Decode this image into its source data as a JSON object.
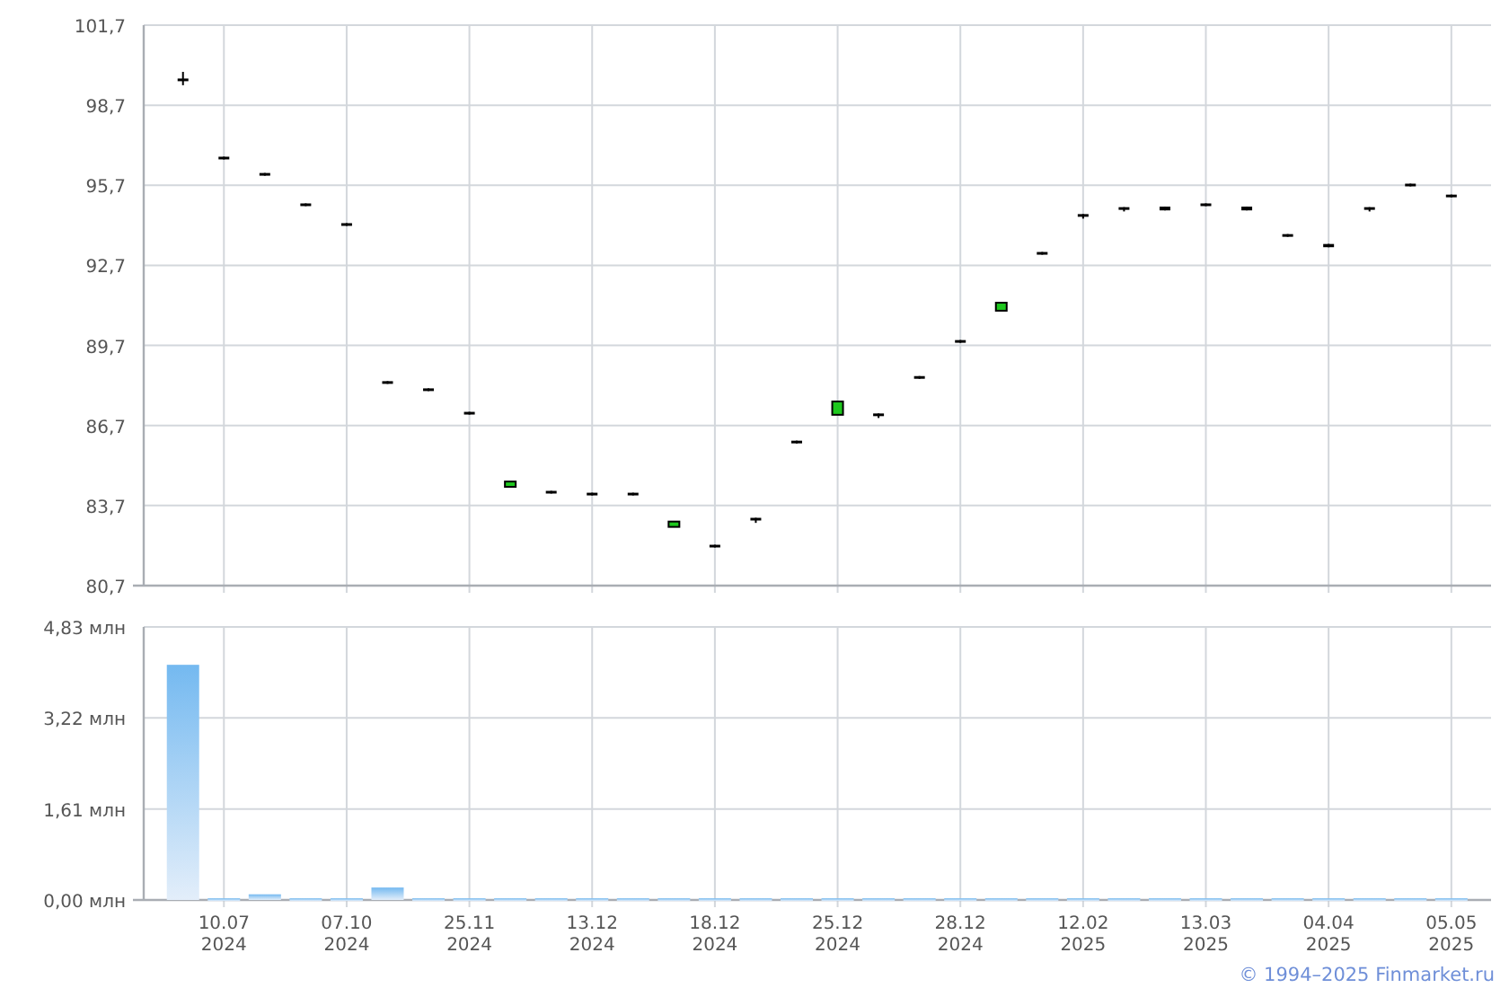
{
  "price_chart": {
    "chart_data": {
      "type": "candlestick",
      "categories": [
        null,
        null,
        null,
        null,
        null,
        null,
        null,
        null,
        null,
        null,
        null,
        null,
        null,
        null,
        null,
        null,
        null,
        null,
        null,
        null,
        null,
        null,
        null,
        null,
        null,
        null,
        null,
        null,
        null,
        null,
        null,
        null
      ],
      "grid": true,
      "ohlc": [
        [
          99.7,
          99.95,
          99.45,
          99.6
        ],
        [
          96.77,
          96.77,
          96.67,
          96.67
        ],
        [
          96.16,
          96.16,
          96.06,
          96.06
        ],
        [
          95.02,
          95.02,
          94.92,
          94.92
        ],
        [
          94.28,
          94.28,
          94.18,
          94.18
        ],
        [
          88.36,
          88.36,
          88.26,
          88.26
        ],
        [
          88.09,
          88.09,
          87.99,
          87.99
        ],
        [
          87.21,
          87.21,
          87.11,
          87.11
        ],
        [
          84.4,
          84.6,
          84.4,
          84.6
        ],
        [
          84.25,
          84.25,
          84.15,
          84.15
        ],
        [
          84.18,
          84.18,
          84.08,
          84.08
        ],
        [
          84.18,
          84.18,
          84.08,
          84.08
        ],
        [
          82.9,
          83.1,
          82.9,
          83.1
        ],
        [
          82.23,
          82.23,
          82.13,
          82.13
        ],
        [
          83.24,
          83.24,
          83.05,
          83.14
        ],
        [
          86.13,
          86.13,
          86.03,
          86.03
        ],
        [
          87.1,
          87.6,
          87.1,
          87.6
        ],
        [
          87.15,
          87.15,
          86.98,
          87.05
        ],
        [
          88.55,
          88.55,
          88.45,
          88.45
        ],
        [
          89.9,
          89.9,
          89.8,
          89.8
        ],
        [
          91.0,
          91.3,
          91.0,
          91.3
        ],
        [
          93.2,
          93.2,
          93.1,
          93.1
        ],
        [
          94.62,
          94.62,
          94.45,
          94.52
        ],
        [
          94.88,
          94.88,
          94.72,
          94.78
        ],
        [
          94.9,
          94.9,
          94.76,
          94.76
        ],
        [
          95.02,
          95.02,
          94.92,
          94.92
        ],
        [
          94.9,
          94.9,
          94.76,
          94.76
        ],
        [
          93.87,
          93.87,
          93.77,
          93.77
        ],
        [
          93.5,
          93.5,
          93.38,
          93.38
        ],
        [
          94.88,
          94.88,
          94.72,
          94.78
        ],
        [
          95.76,
          95.76,
          95.66,
          95.66
        ],
        [
          95.35,
          95.35,
          95.25,
          95.25
        ]
      ],
      "ylim": [
        80.7,
        101.7
      ],
      "yticks": [
        {
          "value": 80.7,
          "label": "80,7"
        },
        {
          "value": 83.7,
          "label": "83,7"
        },
        {
          "value": 86.7,
          "label": "86,7"
        },
        {
          "value": 89.7,
          "label": "89,7"
        },
        {
          "value": 92.7,
          "label": "92,7"
        },
        {
          "value": 95.7,
          "label": "95,7"
        },
        {
          "value": 98.7,
          "label": "98,7"
        },
        {
          "value": 101.7,
          "label": "101,7"
        }
      ]
    }
  },
  "volume_chart": {
    "chart_data": {
      "type": "bar",
      "grid": true,
      "categories": [
        null,
        "10.07\n2024",
        null,
        null,
        "07.10\n2024",
        null,
        null,
        "25.11\n2024",
        null,
        null,
        "13.12\n2024",
        null,
        null,
        "18.12\n2024",
        null,
        null,
        "25.12\n2024",
        null,
        null,
        "28.12\n2024",
        null,
        null,
        "12.02\n2025",
        null,
        null,
        "13.03\n2025",
        null,
        null,
        "04.04\n2025",
        null,
        null,
        "05.05\n2025"
      ],
      "series": [
        {
          "color": "#74b9f0",
          "values": [
            4.16,
            0.03,
            0.1,
            0.03,
            0.03,
            0.22,
            0.03,
            0.03,
            0.03,
            0.03,
            0.03,
            0.03,
            0.03,
            0.03,
            0.03,
            0.03,
            0.03,
            0.03,
            0.03,
            0.03,
            0.03,
            0.03,
            0.03,
            0.03,
            0.03,
            0.03,
            0.03,
            0.03,
            0.03,
            0.03,
            0.03,
            0.03
          ]
        }
      ],
      "ylim": [
        0,
        4.83
      ],
      "yticks": [
        {
          "value": 0,
          "label": "0,00 млн"
        },
        {
          "value": 1.61,
          "label": "1,61 млн"
        },
        {
          "value": 3.22,
          "label": "3,22 млн"
        },
        {
          "value": 4.83,
          "label": "4,83 млн"
        }
      ]
    }
  },
  "copyright": "© 1994–2025 Finmarket.ru"
}
